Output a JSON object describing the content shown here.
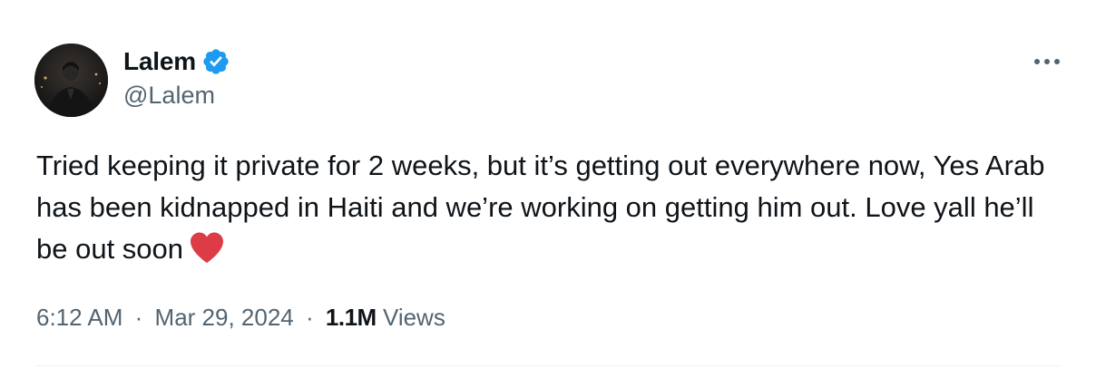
{
  "author": {
    "display_name": "Lalem",
    "handle": "@Lalem",
    "verified_icon": "verified-badge-icon",
    "avatar_icon": "profile-photo"
  },
  "more_icon": "more-horizontal-icon",
  "tweet": {
    "text": "Tried keeping it private for 2 weeks, but it’s getting out everywhere now, Yes Arab has been kidnapped in Haiti and we’re working on getting him out. Love yall he’ll be out soon",
    "emoji": "red-heart-icon"
  },
  "meta": {
    "time": "6:12 AM",
    "separator": "·",
    "date": "Mar 29, 2024",
    "views_count": "1.1M",
    "views_label": "Views"
  },
  "colors": {
    "text_primary": "#0f1419",
    "text_secondary": "#536471",
    "verified_blue": "#1d9bf0",
    "heart_red": "#e0245e"
  }
}
